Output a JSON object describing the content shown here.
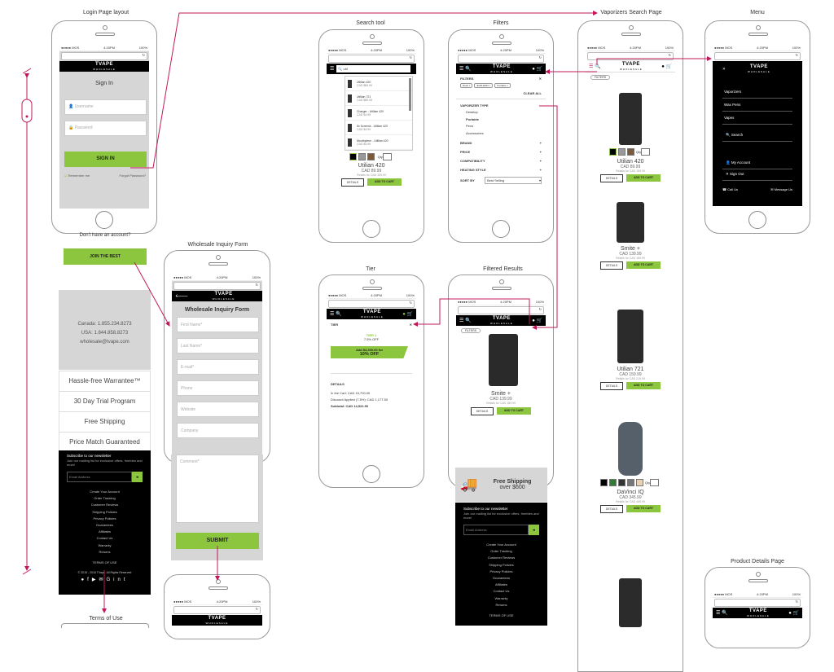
{
  "titles": {
    "login": "Login Page layout",
    "search": "Search tool",
    "filters": "Filters",
    "vaporizers": "Vaporizers Search Page",
    "menu": "Menu",
    "wholesale": "Wholesale Inquiry Form",
    "tier": "Tier",
    "filtered": "Filtered Results",
    "details": "Product Details Page",
    "terms": "Terms of Use"
  },
  "status": {
    "carrier": "●●●●● MOS",
    "time": "4:20PM",
    "battery": "100%"
  },
  "brand": {
    "logo": "TVAPE",
    "sub": "WHOLESALE",
    "accent": "#8cc63f",
    "link": "#c2185b"
  },
  "login": {
    "heading": "Sign In",
    "user_ph": "Username",
    "pass_ph": "Password",
    "signin": "SIGN IN",
    "remember": "Remember me",
    "forgot": "Forgot Password?"
  },
  "account": {
    "prompt": "Don't have an account?",
    "join": "JOIN THE BEST"
  },
  "contact": {
    "canada": "Canada: 1.855.234.8273",
    "usa": "USA: 1.844.858.8273",
    "email": "wholesale@tvape.com"
  },
  "features": [
    "Hassle-free Warrantee™",
    "30 Day Trial Program",
    "Free Shipping",
    "Price Match Guaranteed"
  ],
  "newsletter": {
    "title": "Subscribe to our newsletter",
    "desc": "Join our mailing list for exclusive offers, freebies and more!",
    "placeholder": "Email Address"
  },
  "footer_links": [
    "Create Your Account",
    "Order Tracking",
    "Customer Reviews",
    "Shipping Policies",
    "Privacy Policies",
    "Guarantees",
    "Affiliates",
    "Contact Us",
    "Warranty",
    "Returns"
  ],
  "footer": {
    "terms": "TERMS OF USE",
    "copy": "© 2015 - 2016 TVape. All Rights Reserved"
  },
  "wholesale": {
    "heading": "Wholesale Inquiry Form",
    "fields": [
      "First Name*",
      "Last Name*",
      "E-mail*",
      "Phone",
      "Website",
      "Company"
    ],
    "comment": "Comment*",
    "submit": "SUBMIT"
  },
  "search": {
    "query": "util",
    "results": [
      {
        "name": "Utillian 420",
        "price": "CAD $89.99"
      },
      {
        "name": "Utillian 721",
        "price": "CAD $89.99"
      },
      {
        "name": "Charger - Utillian 420",
        "price": "CAD $4.99"
      },
      {
        "name": "5x Screens - Utillian 420",
        "price": "CAD $4.99"
      },
      {
        "name": "Mouthpiece - Utillian 420",
        "price": "CAD $4.99"
      }
    ],
    "product": "Utilian 420",
    "price": "CAD 89.99",
    "retail": "Retails for CAD 159.99",
    "details": "DETAILS",
    "add": "ADD TO CART",
    "qty": "Qty"
  },
  "filters": {
    "heading": "FILTERS",
    "chips": [
      "Desk",
      "$100-$200",
      "Portable"
    ],
    "clear": "CLEAR ALL",
    "group": "VAPORIZER TYPE",
    "options": [
      "Desktop",
      "Portable",
      "Pens",
      "Accessories"
    ],
    "sections": [
      "BRAND",
      "PRICE",
      "COMPATIBILITY",
      "HEATING STYLE"
    ],
    "sort": "SORT BY",
    "sort_value": "Best Selling"
  },
  "vaporizers": {
    "chip": "FILTERS",
    "products": [
      {
        "name": "Utilian 420",
        "price": "CAD 89.99",
        "retail": "Retails for CAD 159.99"
      },
      {
        "name": "Smite +",
        "price": "CAD 139.99",
        "retail": "Retails for CAD 189.99"
      },
      {
        "name": "Utilian 721",
        "price": "CAD 159.99",
        "retail": "Retails for CAD 219.99"
      },
      {
        "name": "DaVinci IQ",
        "price": "CAD 345.99",
        "retail": "Retails for CAD 459.99"
      }
    ]
  },
  "menu": {
    "items": [
      "Vaporizers",
      "Wax Pens",
      "Vapes"
    ],
    "search": "Search",
    "account": "My Account",
    "signout": "Sign Out",
    "call": "Call Us",
    "message": "Message Us"
  },
  "tier": {
    "heading": "TIER",
    "name": "TIER 1",
    "pct": "7.5% OFF",
    "offer1": "Add $4,300.00 for",
    "offer2": "10% OFF",
    "details": "DETAILS",
    "cart": "In the Cart: CAD 15,700.00",
    "discount": "Discount Applied (7.5%): CAD 1,177.50",
    "subtotal": "Subtotal: CAD 14,522.50"
  },
  "filtered": {
    "chip": "FILTERS",
    "product": "Smite +",
    "price": "CAD 139.99",
    "retail": "Retails for CAD 189.99",
    "ship1": "Free Shipping",
    "ship2": "over $600"
  }
}
